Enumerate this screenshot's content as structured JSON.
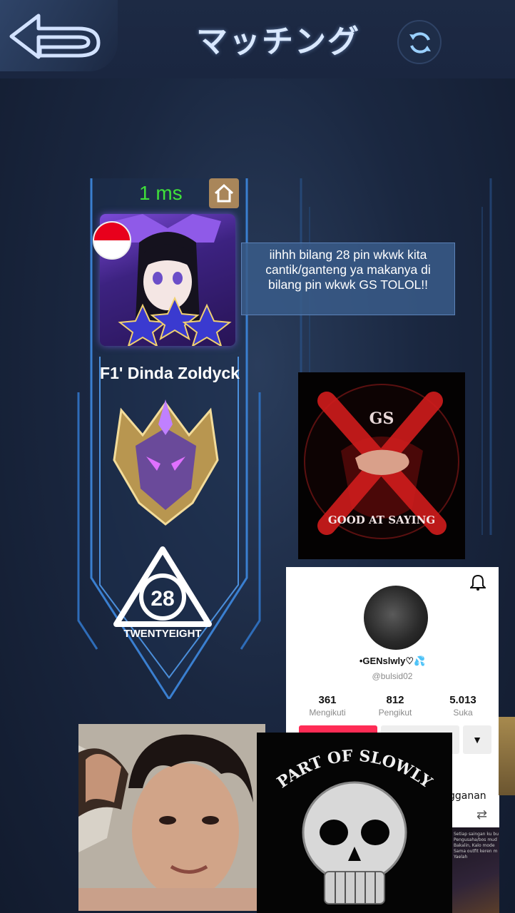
{
  "header": {
    "title": "マッチング"
  },
  "player": {
    "ping": "1 ms",
    "name": "F1' Dinda Zoldyck",
    "team_number": "28",
    "team_name": "TWENTYEIGHT"
  },
  "chat": {
    "message": "iihhh bilang 28 pin wkwk kita cantik/ganteng ya makanya di bilang pin wkwk GS TOLOL!!"
  },
  "gs_image": {
    "logo_text": "GS",
    "caption": "GOOD AT SAYING"
  },
  "profile": {
    "username": "•GENslwly♡💦",
    "handle": "@bulsid02",
    "stats": [
      {
        "value": "361",
        "label": "Mengikuti"
      },
      {
        "value": "812",
        "label": "Pengikut"
      },
      {
        "value": "5.013",
        "label": "Suka"
      }
    ],
    "partial_text": "gganan",
    "thumbnail_text": "Setiap saingan ku bu Pengusaha/bos mud Bakalin, Kalo mode Sama outfit keren m Yaelah"
  },
  "skull_image": {
    "caption": "PART OF SLOWLY"
  },
  "colors": {
    "ping_green": "#3fe03a",
    "follow_red": "#fe2c55",
    "chat_bg": "#3a5c8a"
  }
}
